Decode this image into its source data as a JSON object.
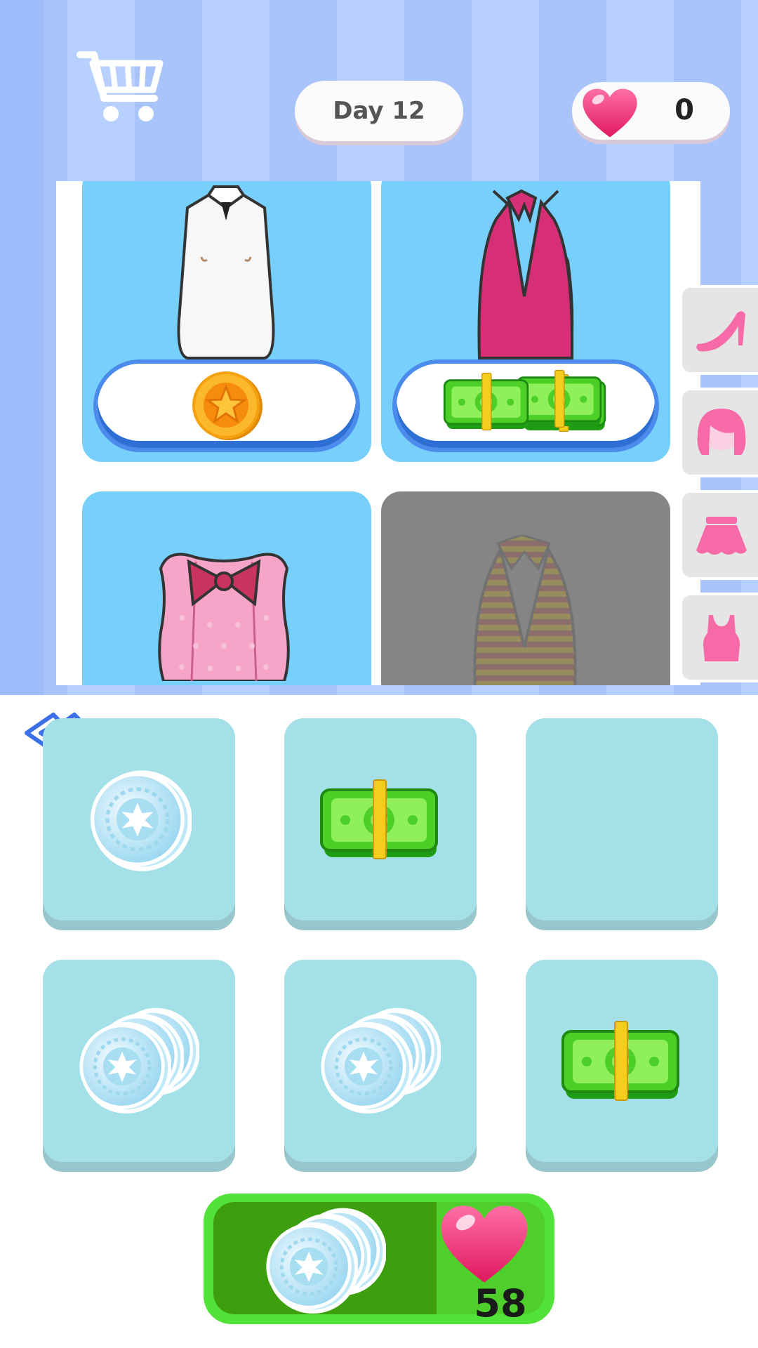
{
  "header": {
    "cart_icon": "shopping-cart-icon",
    "day_label": "Day 12",
    "likes_count": "0",
    "likes_icon": "heart-icon"
  },
  "shop": {
    "items": [
      {
        "name": "white-collar-tank",
        "price_icon": "gold-star-coin-icon",
        "locked": false
      },
      {
        "name": "pink-halter-top",
        "price_icon": "cash-stack-icon",
        "locked": false
      },
      {
        "name": "pink-bow-corset",
        "locked": false
      },
      {
        "name": "striped-halter-top",
        "locked": true
      }
    ],
    "categories": [
      {
        "name": "shoes",
        "icon": "high-heel-icon"
      },
      {
        "name": "hair",
        "icon": "wig-icon"
      },
      {
        "name": "skirts",
        "icon": "skirt-icon"
      },
      {
        "name": "tops",
        "icon": "tank-top-icon"
      }
    ]
  },
  "rewards": {
    "back_icon": "double-chevron-left-icon",
    "tiles": [
      {
        "icon": "silver-coin-icon"
      },
      {
        "icon": "cash-bundle-icon"
      },
      {
        "icon": "empty"
      },
      {
        "icon": "silver-coins-pile-icon"
      },
      {
        "icon": "silver-coins-pile-icon"
      },
      {
        "icon": "cash-bundle-icon"
      }
    ]
  },
  "summary": {
    "coin_icon": "silver-coins-pile-icon",
    "heart_icon": "heart-icon",
    "total": "58"
  },
  "colors": {
    "stripe_light": "#b8d0ff",
    "stripe_dark": "#a9c4fb",
    "card_sky": "#77d0fb",
    "tile": "#a4e0e8",
    "summary_green": "#52e33b",
    "heart_pink": "#ee2f7a"
  }
}
